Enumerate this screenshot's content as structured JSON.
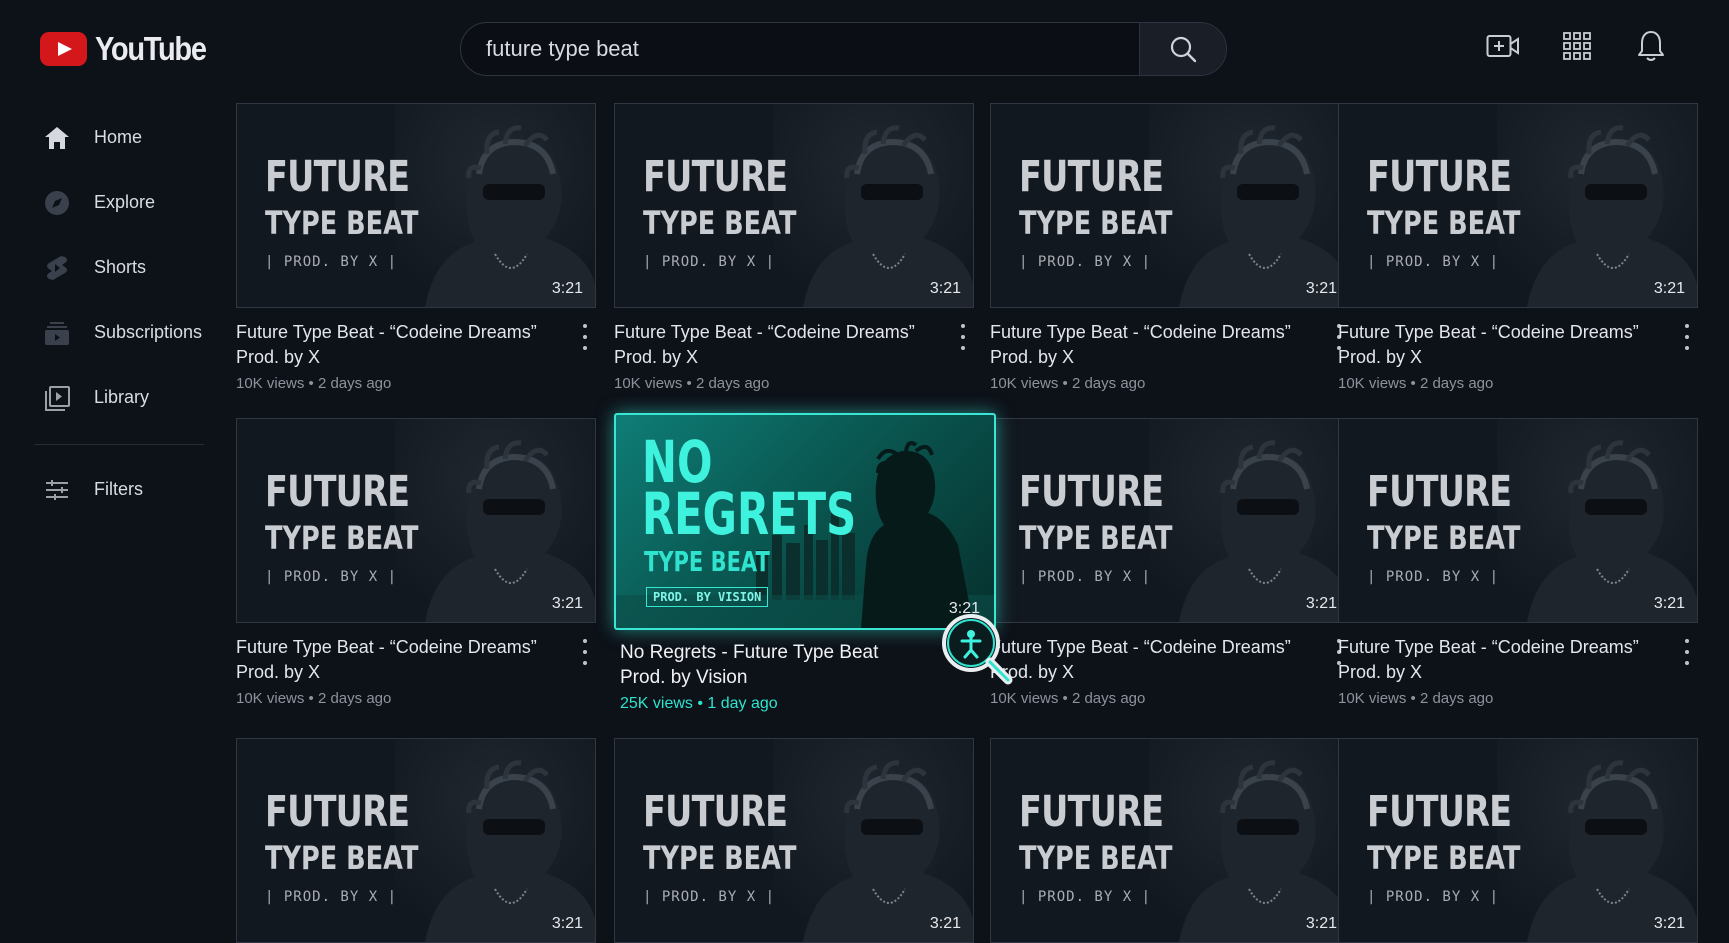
{
  "brand": {
    "name": "YouTube",
    "accent": "#d4171b",
    "highlight": "#39e6d3"
  },
  "search": {
    "value": "future type beat"
  },
  "top_icons": [
    "create-video-icon",
    "apps-grid-icon",
    "notifications-bell-icon"
  ],
  "sidebar": {
    "items": [
      {
        "label": "Home",
        "icon": "home-icon"
      },
      {
        "label": "Explore",
        "icon": "compass-icon"
      },
      {
        "label": "Shorts",
        "icon": "shorts-icon"
      },
      {
        "label": "Subscriptions",
        "icon": "subscriptions-icon"
      },
      {
        "label": "Library",
        "icon": "library-icon"
      }
    ],
    "filters": {
      "label": "Filters",
      "icon": "sliders-icon"
    }
  },
  "generic_thumb": {
    "line1": "FUTURE",
    "line2": "TYPE BEAT",
    "line3": "| PROD. BY X |",
    "duration": "3:21"
  },
  "videos": [
    {
      "title": "Future Type Beat - “Codeine Dreams” Prod. by X",
      "stats": "10K views • 2 days ago"
    },
    {
      "title": "Future Type Beat - “Codeine Dreams” Prod. by X",
      "stats": "10K views • 2 days ago"
    },
    {
      "title": "Future Type Beat - “Codeine Dreams” Prod. by X",
      "stats": "10K views • 2 days ago"
    },
    {
      "title": "Future Type Beat - “Codeine Dreams” Prod. by X",
      "stats": "10K views • 2 days ago"
    },
    {
      "title": "Future Type Beat - “Codeine Dreams” Prod. by X",
      "stats": "10K views • 2 days ago"
    },
    {
      "title": "Future Type Beat - “Codeine Dreams” Prod. by X",
      "stats": "10K views • 2 days ago"
    },
    {
      "title": "Future Type Beat - “Codeine Dreams” Prod. by X",
      "stats": "10K views • 2 days ago"
    }
  ],
  "featured": {
    "thumb_line1": "NO",
    "thumb_line2": "REGRETS",
    "thumb_line3": "TYPE BEAT",
    "thumb_line4": "PROD. BY VISION",
    "duration": "3:21",
    "title": "No Regrets - Future Type Beat Prod. by Vision",
    "stats": "25K views • 1 day ago"
  }
}
